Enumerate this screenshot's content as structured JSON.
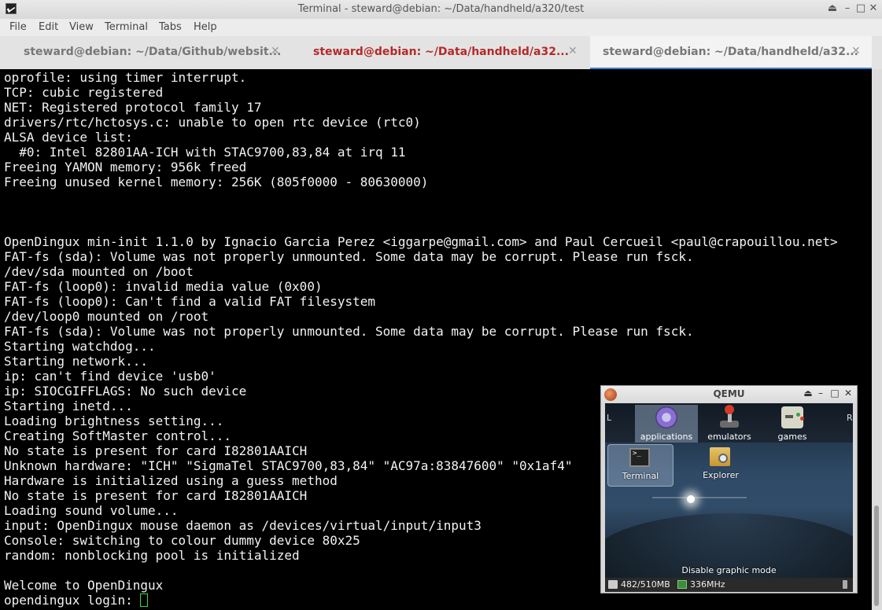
{
  "window": {
    "title": "Terminal - steward@debian: ~/Data/handheld/a320/test",
    "controls": {
      "shade": "⏏",
      "minimize": "–",
      "maximize": "□",
      "close": "✕"
    }
  },
  "menu": [
    "File",
    "Edit",
    "View",
    "Terminal",
    "Tabs",
    "Help"
  ],
  "tabs": [
    {
      "label": "steward@debian: ~/Data/Github/websit...",
      "state": "inactive"
    },
    {
      "label": "steward@debian: ~/Data/handheld/a32...",
      "state": "activity"
    },
    {
      "label": "steward@debian: ~/Data/handheld/a32...",
      "state": "active"
    }
  ],
  "tab_close_glyph": "✕",
  "terminal": {
    "lines": [
      "oprofile: using timer interrupt.",
      "TCP: cubic registered",
      "NET: Registered protocol family 17",
      "drivers/rtc/hctosys.c: unable to open rtc device (rtc0)",
      "ALSA device list:",
      "  #0: Intel 82801AA-ICH with STAC9700,83,84 at irq 11",
      "Freeing YAMON memory: 956k freed",
      "Freeing unused kernel memory: 256K (805f0000 - 80630000)",
      "",
      "",
      "",
      "OpenDingux min-init 1.1.0 by Ignacio Garcia Perez <iggarpe@gmail.com> and Paul Cercueil <paul@crapouillou.net>",
      "FAT-fs (sda): Volume was not properly unmounted. Some data may be corrupt. Please run fsck.",
      "/dev/sda mounted on /boot",
      "FAT-fs (loop0): invalid media value (0x00)",
      "FAT-fs (loop0): Can't find a valid FAT filesystem",
      "/dev/loop0 mounted on /root",
      "FAT-fs (sda): Volume was not properly unmounted. Some data may be corrupt. Please run fsck.",
      "Starting watchdog...",
      "Starting network...",
      "ip: can't find device 'usb0'",
      "ip: SIOCGIFFLAGS: No such device",
      "Starting inetd...",
      "Loading brightness setting...",
      "Creating SoftMaster control...",
      "No state is present for card I82801AAICH",
      "Unknown hardware: \"ICH\" \"SigmaTel STAC9700,83,84\" \"AC97a:83847600\" \"0x1af4\"",
      "Hardware is initialized using a guess method",
      "No state is present for card I82801AAICH",
      "Loading sound volume...",
      "input: OpenDingux mouse daemon as /devices/virtual/input/input3",
      "Console: switching to colour dummy device 80x25",
      "random: nonblocking pool is initialized",
      "",
      "Welcome to OpenDingux"
    ],
    "prompt": "opendingux login: "
  },
  "qemu": {
    "title": "QEMU",
    "controls": {
      "shade": "⏏",
      "minimize": "–",
      "maximize": "□",
      "close": "✕"
    },
    "shoulder_left": "L",
    "shoulder_right": "R",
    "categories": [
      {
        "label": "applications",
        "icon": "gear-icon",
        "selected": true
      },
      {
        "label": "emulators",
        "icon": "joystick-icon",
        "selected": false
      },
      {
        "label": "games",
        "icon": "gamepad-icon",
        "selected": false
      }
    ],
    "apps": [
      {
        "label": "Terminal",
        "icon": "terminal-icon",
        "selected": true
      },
      {
        "label": "Explorer",
        "icon": "folder-search-icon",
        "selected": false
      }
    ],
    "terminal_icon_text": ">_",
    "hint": "Disable graphic mode",
    "status": {
      "memory": "482/510MB",
      "cpu": "336MHz"
    }
  }
}
